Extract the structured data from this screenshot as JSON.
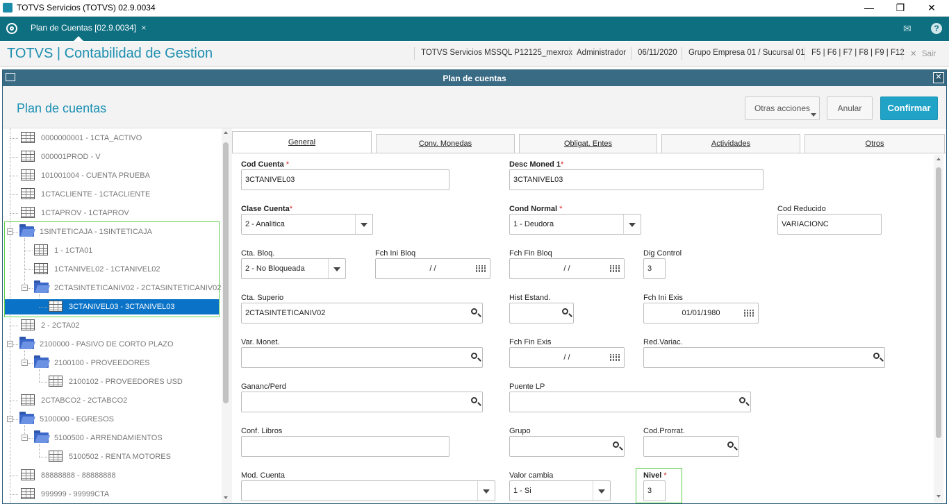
{
  "window": {
    "title": "TOTVS Servicios (TOTVS) 02.9.0034",
    "minimize": "—",
    "restore": "❐",
    "close": "✕"
  },
  "tabbar": {
    "tab_label": "Plan de Cuentas [02.9.0034]",
    "tab_close": "×",
    "mail_icon": "✉",
    "help_icon": "?"
  },
  "header": {
    "app_title": "TOTVS | Contabilidad de Gestion",
    "environment": "TOTVS Servicios MSSQL P12125_mexrox",
    "user": "Administrador",
    "date": "06/11/2020",
    "company": "Grupo Empresa 01 / Sucursal 01",
    "shortcuts": "F5 | F6 | F7 | F8 | F9 | F12",
    "exit_label": "Sair",
    "exit_icon": "✕"
  },
  "dialog": {
    "title": "Plan de cuentas",
    "close": "✕",
    "heading": "Plan de cuentas",
    "buttons": {
      "other_actions": "Otras acciones",
      "cancel": "Anular",
      "confirm": "Confirmar"
    }
  },
  "tree": {
    "nodes": [
      {
        "label": "0000000001 - 1CTA_ACTIVO",
        "type": "table"
      },
      {
        "label": "000001PROD - V",
        "type": "table"
      },
      {
        "label": "101001004 - CUENTA PRUEBA",
        "type": "table"
      },
      {
        "label": "1CTACLIENTE - 1CTACLIENTE",
        "type": "table"
      },
      {
        "label": "1CTAPROV - 1CTAPROV",
        "type": "table"
      },
      {
        "label": "1SINTETICAJA - 1SINTETICAJA",
        "type": "folder",
        "expanded": true
      },
      {
        "label": "1 - 1CTA01",
        "type": "table"
      },
      {
        "label": "1CTANIVEL02 - 1CTANIVEL02",
        "type": "table"
      },
      {
        "label": "2CTASINTETICANIV02 - 2CTASINTETICANIV02",
        "type": "folder",
        "expanded": true
      },
      {
        "label": "3CTANIVEL03 - 3CTANIVEL03",
        "type": "table",
        "selected": true
      },
      {
        "label": "2 - 2CTA02",
        "type": "table"
      },
      {
        "label": "2100000 - PASIVO DE CORTO PLAZO",
        "type": "folder",
        "expanded": true
      },
      {
        "label": "2100100 - PROVEEDORES",
        "type": "folder",
        "expanded": true
      },
      {
        "label": "2100102 - PROVEEDORES USD",
        "type": "table"
      },
      {
        "label": "2CTABCO2 - 2CTABCO2",
        "type": "table"
      },
      {
        "label": "5100000 - EGRESOS",
        "type": "folder",
        "expanded": true
      },
      {
        "label": "5100500 - ARRENDAMIENTOS",
        "type": "folder",
        "expanded": true
      },
      {
        "label": "5100502 - RENTA MOTORES",
        "type": "table"
      },
      {
        "label": "88888888 - 88888888",
        "type": "table"
      },
      {
        "label": "999999 - 99999CTA",
        "type": "table"
      }
    ],
    "expander_minus": "−"
  },
  "tabs": [
    "General",
    "Conv. Monedas",
    "Obligat. Entes",
    "Actividades",
    "Otros"
  ],
  "form": {
    "cod_cuenta": {
      "label": "Cod Cuenta",
      "value": "3CTANIVEL03",
      "req": "*"
    },
    "desc_moned1": {
      "label": "Desc Moned 1",
      "value": "3CTANIVEL03",
      "req": "*"
    },
    "clase_cuenta": {
      "label": "Clase Cuenta",
      "value": "2 - Analitica",
      "req": "*"
    },
    "cond_normal": {
      "label": "Cond Normal",
      "value": "1 - Deudora",
      "req": "*"
    },
    "cod_reducido": {
      "label": "Cod Reducido",
      "value": "VARIACIONC"
    },
    "cta_bloq": {
      "label": "Cta. Bloq.",
      "value": "2 - No Bloqueada"
    },
    "fch_ini_bloq": {
      "label": "Fch Ini Bloq",
      "value": "/  /"
    },
    "fch_fin_bloq": {
      "label": "Fch Fin Bloq",
      "value": "/  /"
    },
    "dig_control": {
      "label": "Dig Control",
      "value": "3"
    },
    "cta_superio": {
      "label": "Cta. Superio",
      "value": "2CTASINTETICANIV02"
    },
    "hist_estand": {
      "label": "Hist Estand.",
      "value": ""
    },
    "fch_ini_exis": {
      "label": "Fch Ini Exis",
      "value": "01/01/1980"
    },
    "var_monet": {
      "label": "Var. Monet.",
      "value": ""
    },
    "fch_fin_exis": {
      "label": "Fch Fin Exis",
      "value": "/  /"
    },
    "red_variac": {
      "label": "Red.Variac.",
      "value": ""
    },
    "ganan_perd": {
      "label": "Gananc/Perd",
      "value": ""
    },
    "puente_lp": {
      "label": "Puente LP",
      "value": ""
    },
    "conf_libros": {
      "label": "Conf. Libros",
      "value": ""
    },
    "grupo": {
      "label": "Grupo",
      "value": ""
    },
    "cod_prorrat": {
      "label": "Cod.Prorrat.",
      "value": ""
    },
    "mod_cuenta": {
      "label": "Mod. Cuenta",
      "value": ""
    },
    "valor_cambia": {
      "label": "Valor cambia",
      "value": "1 - Si"
    },
    "nivel": {
      "label": "Nivel",
      "value": "3",
      "req": "*"
    }
  },
  "colors": {
    "teal_bar": "#0e6f80",
    "brand_blue": "#1c8fb0",
    "confirm": "#20a3c7",
    "selection": "#0a73c8",
    "highlight": "#5fcf4a"
  }
}
